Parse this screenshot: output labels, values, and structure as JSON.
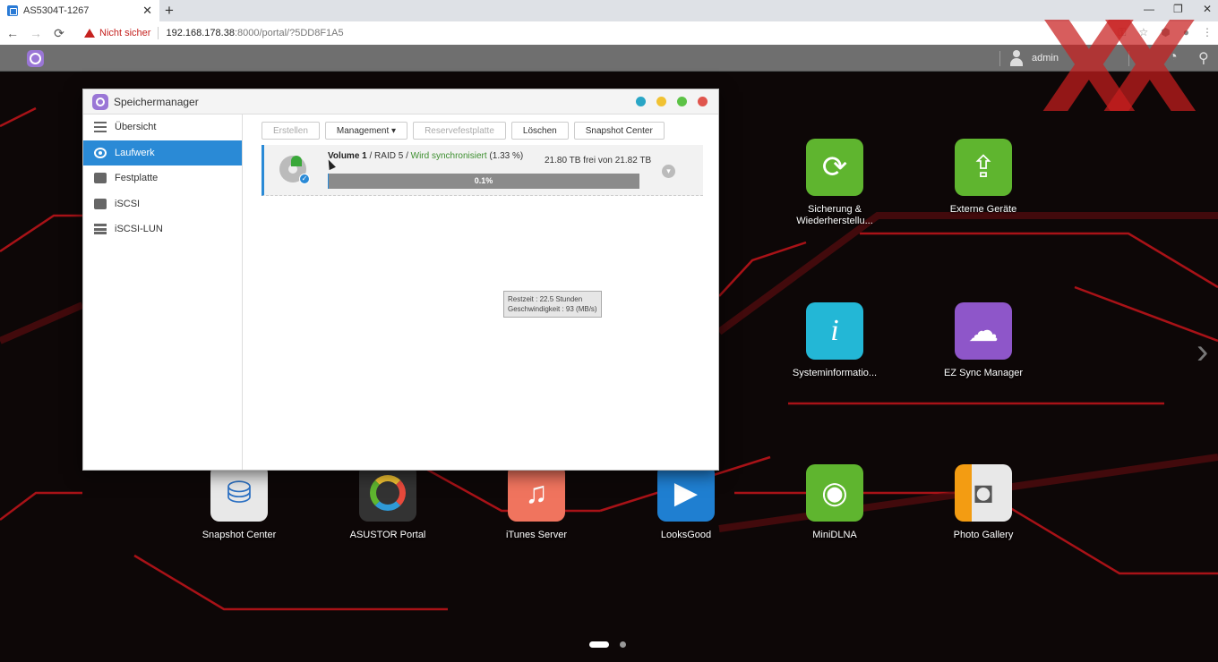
{
  "browser": {
    "tab_title": "AS5304T-1267",
    "tab_close": "✕",
    "new_tab": "+",
    "window_controls": [
      "—",
      "❐",
      "✕"
    ],
    "security_label": "Nicht sicher",
    "url_host": "192.168.178.38",
    "url_path": ":8000/portal/?5DD8F1A5"
  },
  "adm_bar": {
    "user": "admin"
  },
  "window": {
    "title": "Speichermanager",
    "control_colors": [
      "#2aa6c6",
      "#f1c232",
      "#5cc246",
      "#e0554d"
    ]
  },
  "sidebar": {
    "items": [
      {
        "label": "Übersicht",
        "icon": "list-icon"
      },
      {
        "label": "Laufwerk",
        "icon": "drive-icon",
        "active": true
      },
      {
        "label": "Festplatte",
        "icon": "hdd-icon"
      },
      {
        "label": "iSCSI",
        "icon": "server-icon"
      },
      {
        "label": "iSCSI-LUN",
        "icon": "database-icon"
      }
    ]
  },
  "toolbar": {
    "create": "Erstellen",
    "management": "Management ▾",
    "spare": "Reservefestplatte",
    "delete": "Löschen",
    "snapshot": "Snapshot Center"
  },
  "volume": {
    "name": "Volume 1",
    "raid": " / RAID 5 / ",
    "status": "Wird synchronisiert",
    "status_pct": " (1.33 %)",
    "free": "21.80 TB frei von 21.82 TB",
    "progress_label": "0.1%",
    "progress_value": 0.1,
    "tooltip_line1": "Restzeit : 22.5 Stunden",
    "tooltip_line2": "Geschwindigkeit : 93 (MB/s)"
  },
  "desktop_apps": [
    {
      "label": "Sicherung & Wiederherstellu...",
      "color": "#5fb52f",
      "icon": "backup-icon"
    },
    {
      "label": "Externe Geräte",
      "color": "#5fb52f",
      "icon": "usb-icon"
    },
    {
      "label": "Systeminformatio...",
      "color": "#23b7d6",
      "icon": "info-icon"
    },
    {
      "label": "EZ Sync Manager",
      "color": "#8e56c9",
      "icon": "cloud-sync-icon"
    },
    {
      "label": "Snapshot Center",
      "color": "#e8e8e8",
      "icon": "snapshot-icon"
    },
    {
      "label": "ASUSTOR Portal",
      "color": "#333333",
      "icon": "portal-icon"
    },
    {
      "label": "iTunes Server",
      "color": "#f0745e",
      "icon": "music-icon"
    },
    {
      "label": "LooksGood",
      "color": "#1f7fd1",
      "icon": "video-icon"
    },
    {
      "label": "MiniDLNA",
      "color": "#5fb52f",
      "icon": "dlna-icon"
    },
    {
      "label": "Photo Gallery",
      "color": "#e74c3c",
      "icon": "camera-icon"
    }
  ],
  "watermark": "XX"
}
